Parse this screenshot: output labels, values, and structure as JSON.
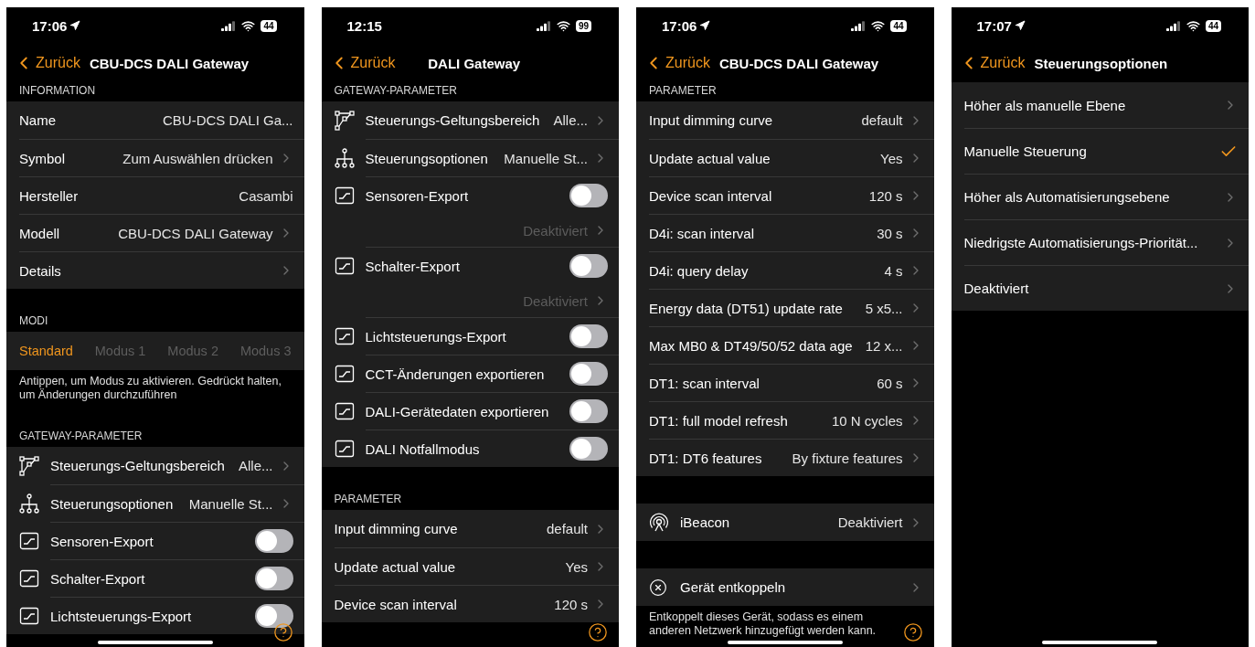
{
  "screens": [
    {
      "status": {
        "time": "17:06",
        "location": true,
        "battery": "44"
      },
      "nav": {
        "back": "Zurück",
        "title": "CBU-DCS DALI Gateway"
      },
      "help": true,
      "home_indicator": true,
      "blocks": [
        {
          "kind": "header",
          "text": "INFORMATION"
        },
        {
          "kind": "group",
          "rows": [
            {
              "kind": "value",
              "label": "Name",
              "value": "CBU-DCS DALI Ga...",
              "chevron": false
            },
            {
              "kind": "value",
              "label": "Symbol",
              "value": "Zum Auswählen drücken",
              "chevron": true
            },
            {
              "kind": "value",
              "label": "Hersteller",
              "value": "Casambi",
              "chevron": false
            },
            {
              "kind": "value",
              "label": "Modell",
              "value": "CBU-DCS DALI Gateway",
              "chevron": true
            },
            {
              "kind": "value",
              "label": "Details",
              "chevron": true
            }
          ]
        },
        {
          "kind": "header",
          "text": "MODI"
        },
        {
          "kind": "modes",
          "tabs": [
            {
              "label": "Standard",
              "selected": true
            },
            {
              "label": "Modus 1",
              "selected": false
            },
            {
              "label": "Modus 2",
              "selected": false
            },
            {
              "label": "Modus 3",
              "selected": false
            }
          ]
        },
        {
          "kind": "note",
          "text": "Antippen, um Modus zu aktivieren. Gedrückt halten, um Änderungen durchzuführen"
        },
        {
          "kind": "header",
          "text": "GATEWAY-PARAMETER"
        },
        {
          "kind": "group",
          "rows": [
            {
              "kind": "scope",
              "label": "Steuerungs-Geltungsbereich",
              "value": "Alle...",
              "chevron": true
            },
            {
              "kind": "tree",
              "label": "Steuerungsoptionen",
              "value": "Manuelle St...",
              "chevron": true
            },
            {
              "kind": "toggle",
              "label": "Sensoren-Export",
              "on": false
            },
            {
              "kind": "toggle",
              "label": "Schalter-Export",
              "on": false
            },
            {
              "kind": "toggle",
              "label": "Lichtsteuerungs-Export",
              "on": false
            }
          ]
        }
      ]
    },
    {
      "status": {
        "time": "12:15",
        "location": false,
        "battery": "99"
      },
      "nav": {
        "back": "Zurück",
        "title": "DALI Gateway"
      },
      "help": true,
      "home_indicator": false,
      "blocks": [
        {
          "kind": "header",
          "text": "GATEWAY-PARAMETER"
        },
        {
          "kind": "group",
          "rows": [
            {
              "kind": "scope",
              "label": "Steuerungs-Geltungsbereich",
              "value": "Alle...",
              "chevron": true
            },
            {
              "kind": "tree",
              "label": "Steuerungsoptionen",
              "value": "Manuelle St...",
              "chevron": true
            },
            {
              "kind": "toggle",
              "label": "Sensoren-Export",
              "on": false,
              "detail": "Deaktiviert"
            },
            {
              "kind": "toggle",
              "label": "Schalter-Export",
              "on": false,
              "detail": "Deaktiviert"
            },
            {
              "kind": "toggle",
              "label": "Lichtsteuerungs-Export",
              "on": false
            },
            {
              "kind": "toggle",
              "label": "CCT-Änderungen exportieren",
              "on": false
            },
            {
              "kind": "toggle",
              "label": "DALI-Gerätedaten exportieren",
              "on": false
            },
            {
              "kind": "toggle",
              "label": "DALI Notfallmodus",
              "on": false
            }
          ]
        },
        {
          "kind": "header",
          "text": "PARAMETER"
        },
        {
          "kind": "group",
          "rows": [
            {
              "kind": "value",
              "label": "Input dimming curve",
              "value": "default",
              "chevron": true
            },
            {
              "kind": "value",
              "label": "Update actual value",
              "value": "Yes",
              "chevron": true
            },
            {
              "kind": "value",
              "label": "Device scan interval",
              "value": "120 s",
              "chevron": true
            }
          ]
        }
      ]
    },
    {
      "status": {
        "time": "17:06",
        "location": true,
        "battery": "44"
      },
      "nav": {
        "back": "Zurück",
        "title": "CBU-DCS DALI Gateway"
      },
      "help": true,
      "home_indicator": true,
      "blocks": [
        {
          "kind": "header",
          "text": "PARAMETER"
        },
        {
          "kind": "group",
          "rows": [
            {
              "kind": "value",
              "label": "Input dimming curve",
              "value": "default",
              "chevron": true
            },
            {
              "kind": "value",
              "label": "Update actual value",
              "value": "Yes",
              "chevron": true
            },
            {
              "kind": "value",
              "label": "Device scan interval",
              "value": "120 s",
              "chevron": true
            },
            {
              "kind": "value",
              "label": "D4i: scan interval",
              "value": "30 s",
              "chevron": true
            },
            {
              "kind": "value",
              "label": "D4i: query delay",
              "value": "4 s",
              "chevron": true
            },
            {
              "kind": "value",
              "label": "Energy data (DT51) update rate",
              "value": "5 x5...",
              "chevron": true
            },
            {
              "kind": "value",
              "label": "Max MB0 & DT49/50/52 data age",
              "value": "12 x...",
              "chevron": true
            },
            {
              "kind": "value",
              "label": "DT1: scan interval",
              "value": "60 s",
              "chevron": true
            },
            {
              "kind": "value",
              "label": "DT1: full model refresh",
              "value": "10 N cycles",
              "chevron": true
            },
            {
              "kind": "value",
              "label": "DT1: DT6 features",
              "value": "By fixture features",
              "chevron": true
            }
          ]
        },
        {
          "kind": "group",
          "rows": [
            {
              "kind": "beacon",
              "label": "iBeacon",
              "value": "Deaktiviert",
              "chevron": true
            }
          ]
        },
        {
          "kind": "group",
          "rows": [
            {
              "kind": "unlink",
              "label": "Gerät entkoppeln",
              "chevron": true
            }
          ]
        },
        {
          "kind": "note",
          "text": "Entkoppelt dieses Gerät, sodass es einem anderen Netzwerk hinzugefügt werden kann."
        }
      ]
    },
    {
      "status": {
        "time": "17:07",
        "location": true,
        "battery": "44"
      },
      "nav": {
        "back": "Zurück",
        "title": "Steuerungsoptionen"
      },
      "help": false,
      "home_indicator": true,
      "blocks": [
        {
          "kind": "group",
          "rows": [
            {
              "kind": "option",
              "label": "Höher als manuelle Ebene",
              "selected": false
            },
            {
              "kind": "option",
              "label": "Manuelle Steuerung",
              "selected": true
            },
            {
              "kind": "option",
              "label": "Höher als Automatisierungsebene",
              "selected": false
            },
            {
              "kind": "option",
              "label": "Niedrigste Automatisierungs-Priorität...",
              "selected": false
            },
            {
              "kind": "option",
              "label": "Deaktiviert",
              "selected": false
            }
          ]
        }
      ]
    }
  ]
}
